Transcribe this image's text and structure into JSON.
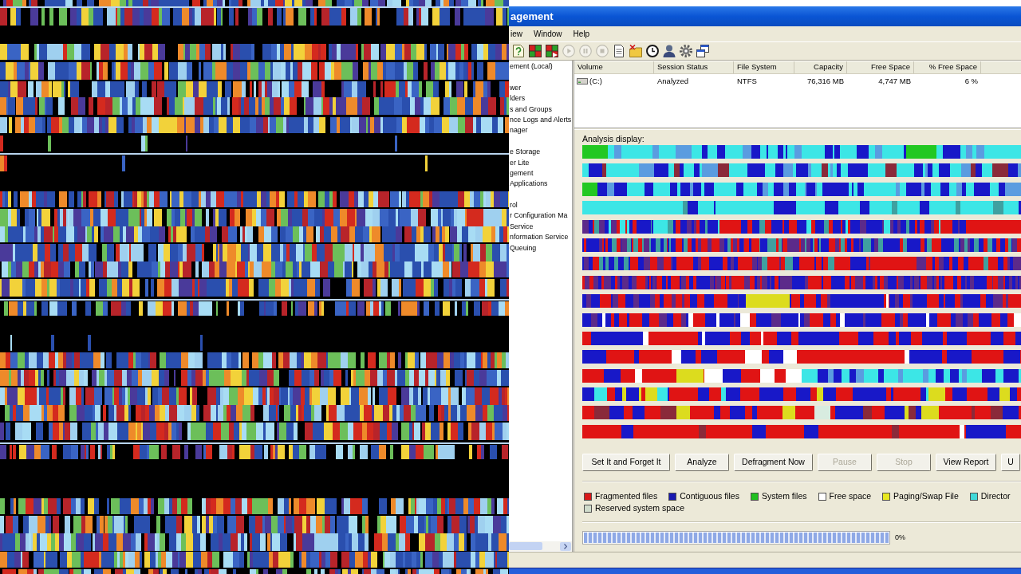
{
  "window": {
    "title": "agement"
  },
  "menu": [
    "iew",
    "Window",
    "Help"
  ],
  "toolbar": [
    {
      "kind": "doc-question",
      "disabled": false
    },
    {
      "kind": "blocks",
      "disabled": false
    },
    {
      "kind": "blocks-arrow",
      "disabled": false
    },
    {
      "kind": "play",
      "disabled": true
    },
    {
      "kind": "pause",
      "disabled": true
    },
    {
      "kind": "stop",
      "disabled": true
    },
    {
      "kind": "document",
      "disabled": false
    },
    {
      "kind": "folder-cross",
      "disabled": false
    },
    {
      "kind": "clock",
      "disabled": false
    },
    {
      "kind": "person",
      "disabled": false
    },
    {
      "kind": "gear",
      "disabled": false
    },
    {
      "kind": "windows",
      "disabled": false
    }
  ],
  "tree": {
    "items": [
      {
        "label": "ement (Local)",
        "children": [
          {
            "children": [
              {
                "label": "wer"
              },
              {
                "label": "lders"
              },
              {
                "label": "s and Groups"
              },
              {
                "label": "nce Logs and Alerts"
              },
              {
                "label": "nager"
              }
            ]
          },
          {
            "children": [
              {
                "label": "e Storage"
              },
              {
                "label": "er Lite"
              },
              {
                "label": "gement"
              }
            ]
          },
          {
            "label": "Applications",
            "children": [
              {
                "children": [
                  {
                    "label": "rol"
                  },
                  {
                    "label": "r Configuration Ma"
                  },
                  {
                    "label": "Service"
                  },
                  {
                    "label": "nformation Service"
                  },
                  {
                    "label": "Queuing"
                  }
                ]
              }
            ]
          }
        ]
      }
    ]
  },
  "volume_list": {
    "columns": [
      "Volume",
      "Session Status",
      "File System",
      "Capacity",
      "Free Space",
      "% Free Space"
    ],
    "rows": [
      {
        "cells": [
          "(C:)",
          "Analyzed",
          "NTFS",
          "76,316 MB",
          "4,747 MB",
          "6 %"
        ]
      }
    ]
  },
  "analysis": {
    "title": "Analysis display:"
  },
  "buttons": [
    {
      "label": "Set It and Forget It",
      "disabled": false
    },
    {
      "label": "Analyze",
      "disabled": false
    },
    {
      "label": "Defragment Now",
      "disabled": false
    },
    {
      "label": "Pause",
      "disabled": true
    },
    {
      "label": "Stop",
      "disabled": true
    },
    {
      "label": "View Report",
      "disabled": false
    },
    {
      "label": "U",
      "disabled": false
    }
  ],
  "legend": [
    {
      "label": "Fragmented files",
      "color": "#d81818"
    },
    {
      "label": "Contiguous files",
      "color": "#1818b0"
    },
    {
      "label": "System files",
      "color": "#20c020"
    },
    {
      "label": "Free space",
      "color": "#ffffff"
    },
    {
      "label": "Paging/Swap File",
      "color": "#e8e820"
    },
    {
      "label": "Director",
      "color": "#40d8d8"
    },
    {
      "label": "Reserved system space",
      "color": "#d0dccc"
    }
  ],
  "progress": {
    "level": 1,
    "reading": "0%"
  }
}
